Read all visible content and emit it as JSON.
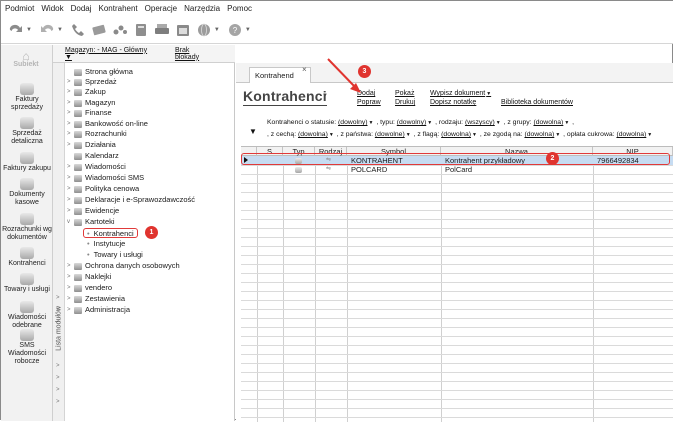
{
  "menu": [
    "Podmiot",
    "Widok",
    "Dodaj",
    "Kontrahent",
    "Operacje",
    "Narzędzia",
    "Pomoc"
  ],
  "toolbar_icons": [
    "back-icon",
    "forward-icon",
    "phone-icon",
    "document-icon",
    "dots-icon",
    "calculator-icon",
    "print-icon",
    "calendar-icon",
    "globe-icon",
    "help-icon"
  ],
  "brand": {
    "logo_text": "Subiekt"
  },
  "iconbar": [
    {
      "name": "faktury-sprzedazy",
      "label": "Faktury sprzedaży",
      "icon": "invoice-icon"
    },
    {
      "name": "sprzedaz-detaliczna",
      "label": "Sprzedaż detaliczna",
      "icon": "cart-icon"
    },
    {
      "name": "faktury-zakupu",
      "label": "Faktury zakupu",
      "icon": "purchase-icon"
    },
    {
      "name": "dokumenty-kasowe",
      "label": "Dokumenty kasowe",
      "icon": "cash-icon"
    },
    {
      "name": "rozrachunki-wg-dokumentow",
      "label": "Rozrachunki wg dokumentów",
      "icon": "ledger-icon"
    },
    {
      "name": "kontrahenci",
      "label": "Kontrahenci",
      "icon": "people-icon"
    },
    {
      "name": "towary-i-uslugi",
      "label": "Towary i usługi",
      "icon": "goods-icon"
    },
    {
      "name": "wiadomosci-odebrane",
      "label": "Wiadomości odebrane",
      "icon": "mail-icon"
    },
    {
      "name": "sms-wiadomosci-robocze",
      "label": "SMS Wiadomości robocze",
      "icon": "sms-icon"
    }
  ],
  "tree_header": {
    "magazyn": "Magazyn: - MAG - Główny ▼",
    "blokady": "Brak blokady"
  },
  "side_tab_label": "Lista modułów",
  "tree": [
    {
      "label": "Strona główna",
      "expander": ""
    },
    {
      "label": "Sprzedaż",
      "expander": ">"
    },
    {
      "label": "Zakup",
      "expander": ">"
    },
    {
      "label": "Magazyn",
      "expander": ">"
    },
    {
      "label": "Finanse",
      "expander": ">"
    },
    {
      "label": "Bankowość on-line",
      "expander": ">"
    },
    {
      "label": "Rozrachunki",
      "expander": ">"
    },
    {
      "label": "Działania",
      "expander": ">"
    },
    {
      "label": "Kalendarz",
      "expander": ""
    },
    {
      "label": "Wiadomości",
      "expander": ">"
    },
    {
      "label": "Wiadomości SMS",
      "expander": ">"
    },
    {
      "label": "Polityka cenowa",
      "expander": ">"
    },
    {
      "label": "Deklaracje i e-Sprawozdawczość",
      "expander": ">"
    },
    {
      "label": "Ewidencje",
      "expander": ">"
    },
    {
      "label": "Kartoteki",
      "expander": "v"
    },
    {
      "label": "Ochrona danych osobowych",
      "expander": ">"
    },
    {
      "label": "Naklejki",
      "expander": ">"
    },
    {
      "label": "vendero",
      "expander": ">"
    },
    {
      "label": "Zestawienia",
      "expander": ">"
    },
    {
      "label": "Administracja",
      "expander": ">"
    }
  ],
  "tree_sub": [
    "Kontrahenci",
    "Instytucje",
    "Towary i usługi"
  ],
  "tab": {
    "label": "Kontrahend",
    "close": "×"
  },
  "page": {
    "title": "Kontrahenci",
    "title_caret": "▼"
  },
  "actions": {
    "dodaj": "Dodaj",
    "popraw": "Popraw",
    "pokaz": "Pokaż",
    "drukuj": "Drukuj",
    "wypisz": "Wypisz dokument",
    "dopisz": "Dopisz notatkę",
    "biblioteka": "Biblioteka dokumentów"
  },
  "filters": {
    "row1": [
      {
        "label": "Kontrahenci o statusie:",
        "value": "(dowolny)"
      },
      {
        "label": ", typu:",
        "value": "(dowolny)"
      },
      {
        "label": ", rodzaju:",
        "value": "(wszyscy)"
      },
      {
        "label": ", z grupy:",
        "value": "(dowolna)"
      }
    ],
    "row1_tail": ",",
    "row2": [
      {
        "label": ", z cechą:",
        "value": "(dowolna)"
      },
      {
        "label": ", z państwa:",
        "value": "(dowolne)"
      },
      {
        "label": ", z flagą:",
        "value": "(dowolna)"
      },
      {
        "label": ", ze zgodą na:",
        "value": "(dowolna)"
      },
      {
        "label": ", opłata cukrowa:",
        "value": "(dowolna)"
      }
    ]
  },
  "grid": {
    "columns": [
      "S",
      "Typ",
      "Rodzaj",
      "Symbol",
      "Nazwa",
      "NIP"
    ],
    "rows": [
      {
        "symbol": "KONTRAHENT",
        "nazwa": "Kontrahent przykładowy",
        "nip": "7966492834",
        "selected": true
      },
      {
        "symbol": "POLCARD",
        "nazwa": "PolCard",
        "nip": "",
        "selected": false
      }
    ]
  },
  "annotations": {
    "step1": "1",
    "step2": "2",
    "step3": "3"
  },
  "colors": {
    "accent_red": "#e0342f",
    "selected_row": "#c6dcf2"
  }
}
